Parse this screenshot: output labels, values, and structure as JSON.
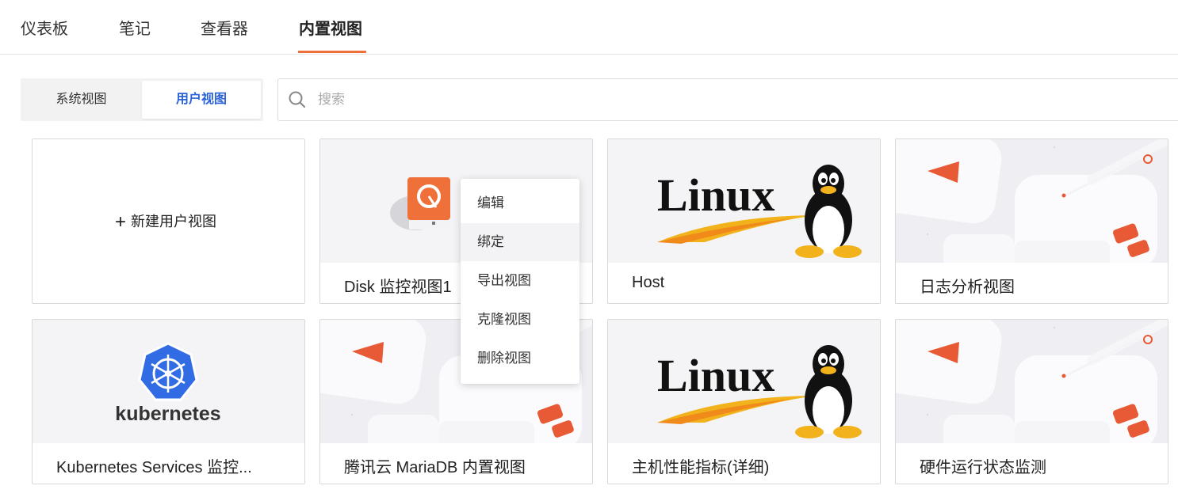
{
  "tabs": [
    {
      "label": "仪表板"
    },
    {
      "label": "笔记"
    },
    {
      "label": "查看器"
    },
    {
      "label": "内置视图"
    }
  ],
  "segment": {
    "system": "系统视图",
    "user": "用户视图"
  },
  "search": {
    "placeholder": "搜索",
    "value": ""
  },
  "new_card": {
    "label": "新建用户视图"
  },
  "cards": [
    {
      "title": "Disk 监控视图1"
    },
    {
      "title": "Host"
    },
    {
      "title": "日志分析视图"
    },
    {
      "title": "Kubernetes Services 监控..."
    },
    {
      "title": "腾讯云 MariaDB 内置视图"
    },
    {
      "title": "主机性能指标(详细)"
    },
    {
      "title": "硬件运行状态监测"
    }
  ],
  "logos": {
    "linux": "Linux",
    "kubernetes": "kubernetes"
  },
  "context_menu": {
    "items": [
      "编辑",
      "绑定",
      "导出视图",
      "克隆视图",
      "删除视图"
    ]
  },
  "colors": {
    "accent": "#f0703a",
    "link": "#2b62d8",
    "k8s": "#326ce5"
  }
}
